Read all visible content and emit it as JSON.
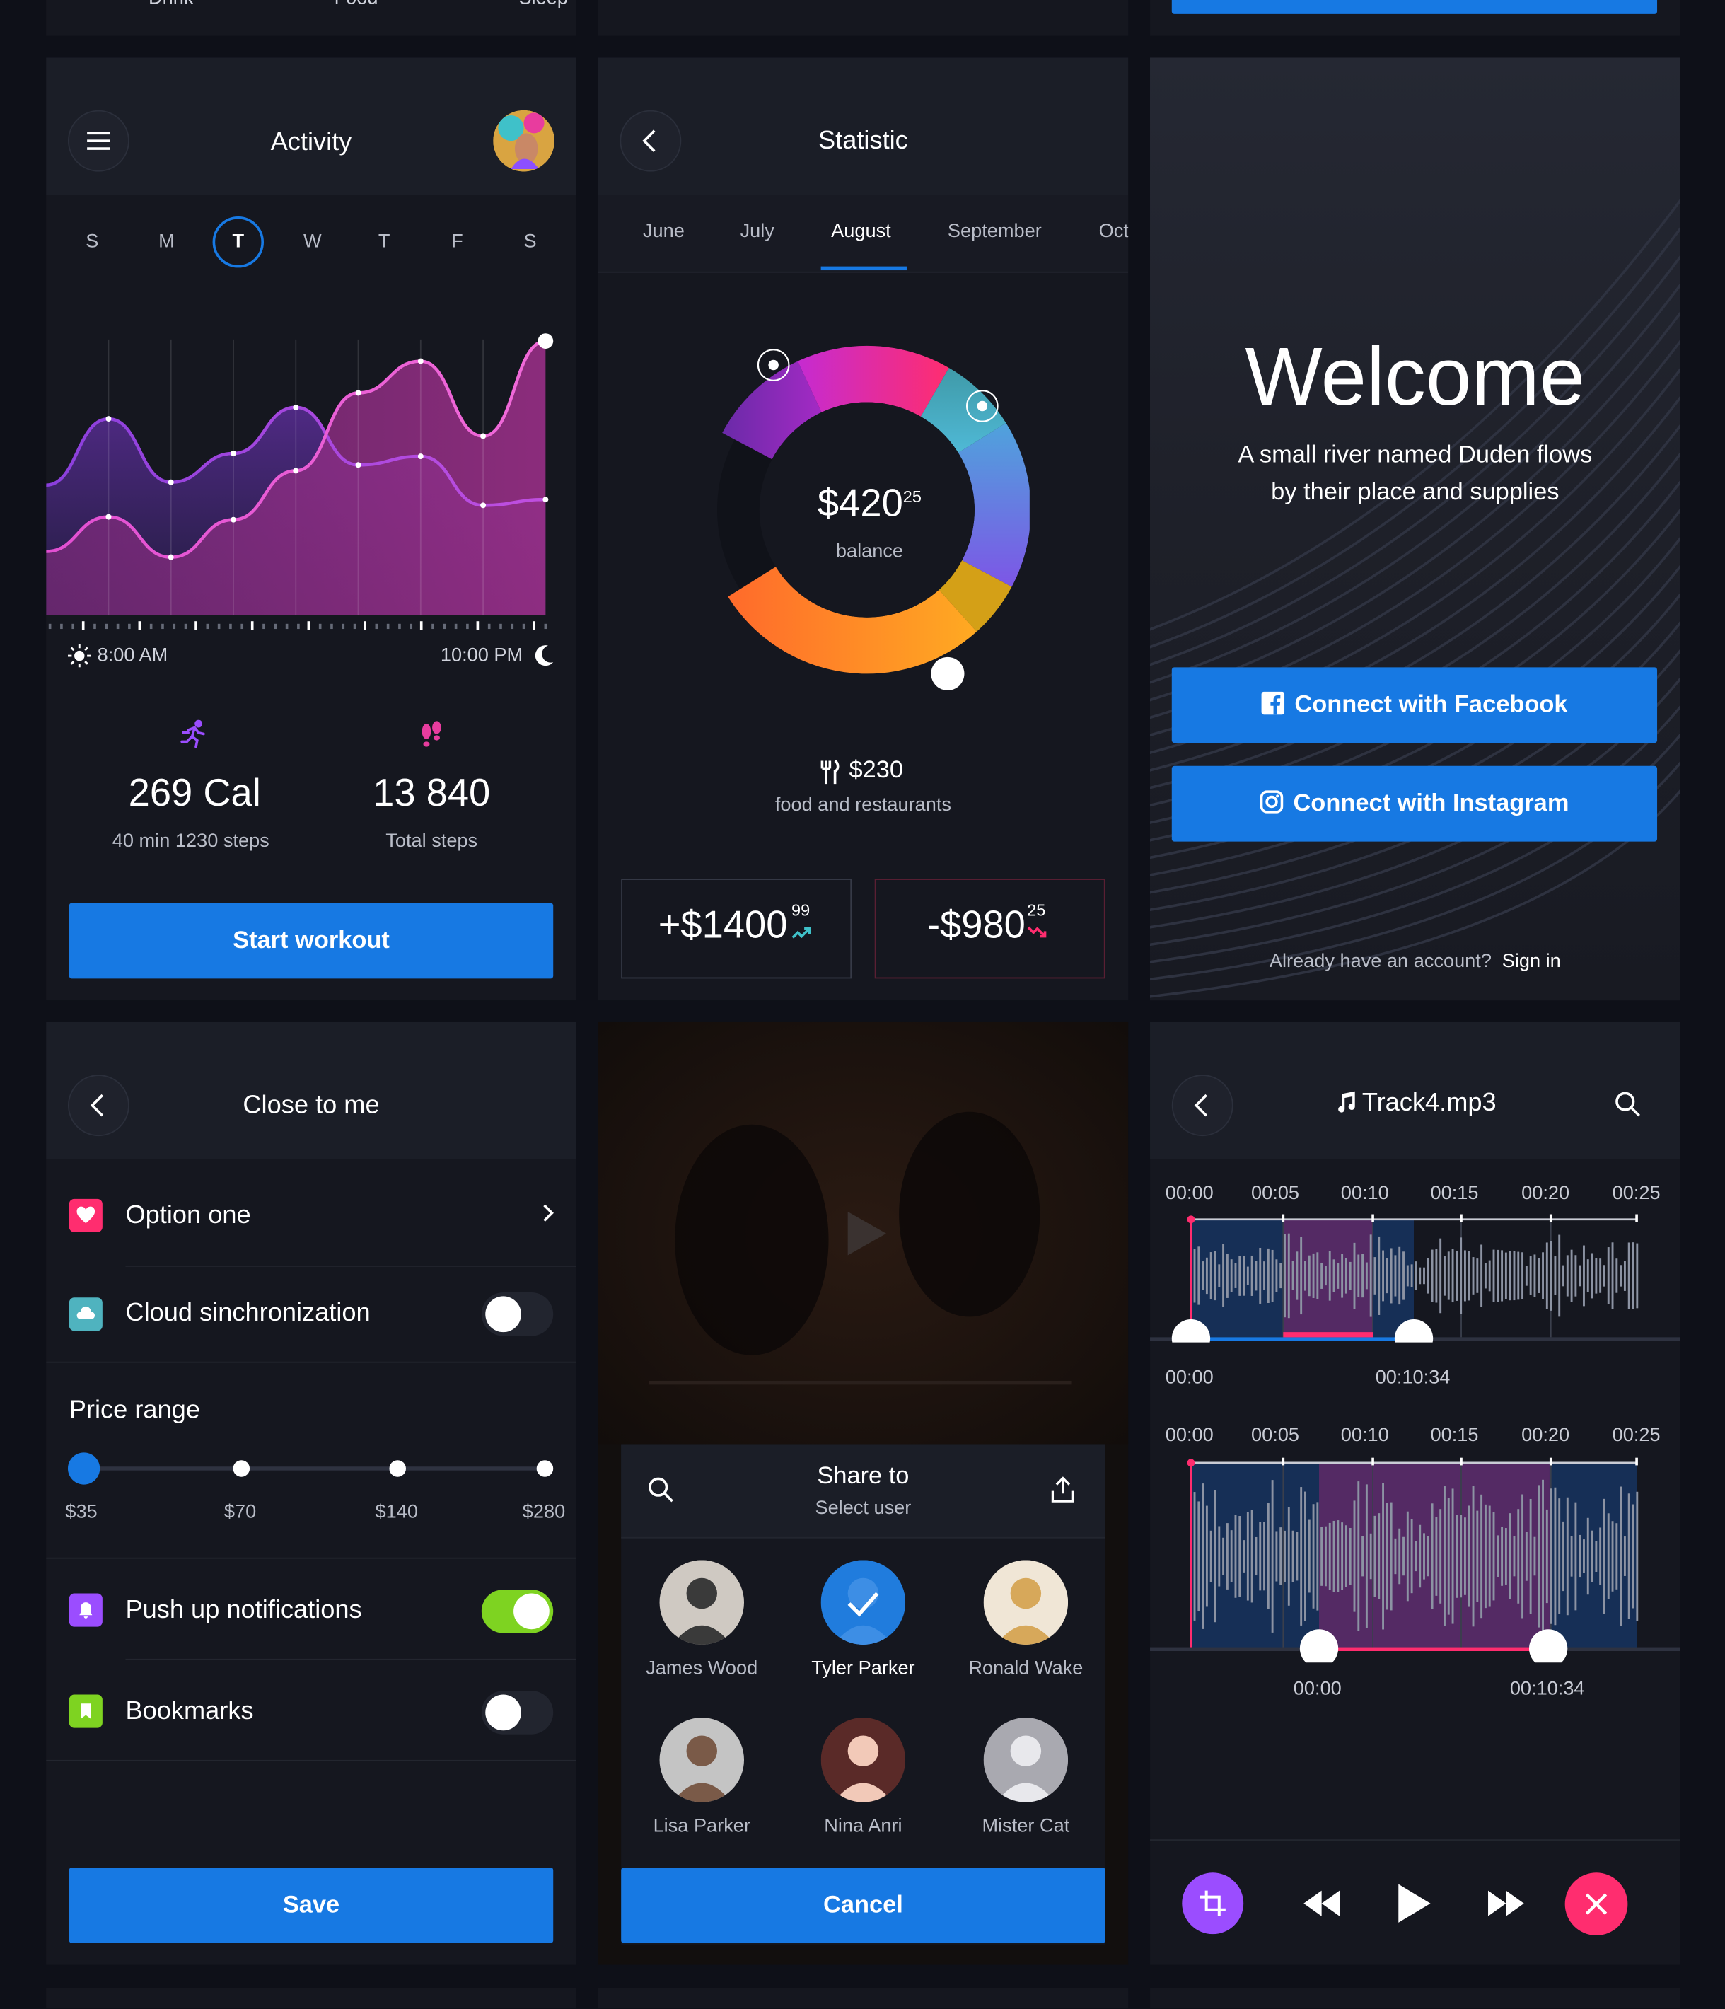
{
  "top_strip": {
    "left_labels": [
      "Drink",
      "Food",
      "Sleep"
    ]
  },
  "activity": {
    "title": "Activity",
    "days": [
      "S",
      "M",
      "T",
      "W",
      "T",
      "F",
      "S"
    ],
    "selected_day": "T",
    "time_start": "8:00 AM",
    "time_end": "10:00 PM",
    "stats": [
      {
        "icon": "running-icon",
        "value": "269 Cal",
        "label": "40 min 1230 steps",
        "color": "#9b4dff"
      },
      {
        "icon": "footprints-icon",
        "value": "13 840",
        "label": "Total steps",
        "color": "#e83c9e"
      }
    ],
    "button": "Start workout",
    "chart_data": {
      "type": "area",
      "series": [
        {
          "values": [
            0.45,
            0.68,
            0.46,
            0.56,
            0.72,
            0.52,
            0.55,
            0.38,
            0.4
          ]
        },
        {
          "values": [
            0.22,
            0.34,
            0.2,
            0.33,
            0.5,
            0.77,
            0.88,
            0.62,
            0.95
          ]
        }
      ]
    }
  },
  "statistic": {
    "title": "Statistic",
    "months": [
      "June",
      "July",
      "August",
      "September",
      "Octo"
    ],
    "active_month": "August",
    "balance_main": "$420",
    "balance_cents": "25",
    "balance_label": "balance",
    "category_amount": "$230",
    "category_label": "food and restaurants",
    "income_main": "+$1400",
    "income_cents": "99",
    "expense_main": "-$980",
    "expense_cents": "25",
    "colors": {
      "income": "#3fc1c9",
      "expense": "#ff2d6f"
    }
  },
  "welcome": {
    "title": "Welcome",
    "subtitle_line1": "A small river named Duden flows",
    "subtitle_line2": "by their place and supplies",
    "facebook_button": "Connect with Facebook",
    "instagram_button": "Connect with Instagram",
    "account_prompt": "Already have an account?",
    "sign_in": "Sign in"
  },
  "close_to_me": {
    "title": "Close to me",
    "options": [
      {
        "label": "Option one",
        "icon": "heart-icon",
        "color": "#ff2d6f",
        "control": "chevron"
      },
      {
        "label": "Cloud sinchronization",
        "icon": "cloud-icon",
        "color": "#4fb3bf",
        "control": "toggle-off"
      }
    ],
    "price_range": {
      "label": "Price range",
      "ticks": [
        "$35",
        "$70",
        "$140",
        "$280"
      ],
      "selected": "$35"
    },
    "options2": [
      {
        "label": "Push up notifications",
        "icon": "bell-icon",
        "color": "#9b4dff",
        "control": "toggle-on"
      },
      {
        "label": "Bookmarks",
        "icon": "bookmark-icon",
        "color": "#7ed321",
        "control": "toggle-off"
      }
    ],
    "button": "Save"
  },
  "share": {
    "title": "Share to",
    "subtitle": "Select user",
    "users": [
      {
        "name": "James Wood",
        "selected": false
      },
      {
        "name": "Tyler Parker",
        "selected": true
      },
      {
        "name": "Ronald Wake",
        "selected": false
      },
      {
        "name": "Lisa Parker",
        "selected": false
      },
      {
        "name": "Nina Anri",
        "selected": false
      },
      {
        "name": "Mister Cat",
        "selected": false
      }
    ],
    "button": "Cancel"
  },
  "audio": {
    "title": "Track4.mp3",
    "timeline": [
      "00:00",
      "00:05",
      "00:10",
      "00:15",
      "00:20",
      "00:25"
    ],
    "clip1": {
      "start": "00:00",
      "end": "00:10:34"
    },
    "clip2": {
      "start": "00:00",
      "end": "00:10:34"
    },
    "colors": {
      "crop": "#9b4dff",
      "close": "#ff2d6f",
      "track1": "#1779e3",
      "track2": "#ff2d6f"
    }
  }
}
